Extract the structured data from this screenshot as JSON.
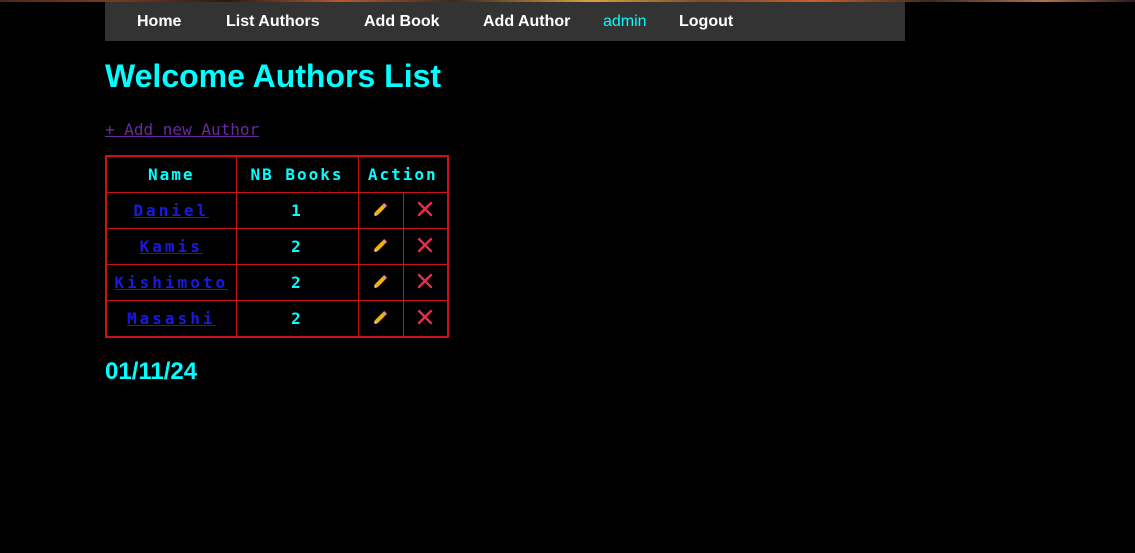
{
  "nav": {
    "home": "Home",
    "list_authors": "List Authors",
    "add_book": "Add Book",
    "add_author": "Add Author",
    "user": "admin",
    "logout": "Logout"
  },
  "page": {
    "title": "Welcome Authors List",
    "add_link": "+ Add new Author",
    "date": "01/11/24"
  },
  "table": {
    "headers": {
      "name": "Name",
      "nb_books": "NB Books",
      "action": "Action"
    },
    "rows": [
      {
        "name": "Daniel",
        "nb_books": "1"
      },
      {
        "name": "Kamis",
        "nb_books": "2"
      },
      {
        "name": "Kishimoto",
        "nb_books": "2"
      },
      {
        "name": "Masashi",
        "nb_books": "2"
      }
    ]
  },
  "icons": {
    "edit": "pencil-icon",
    "delete": "cross-icon"
  },
  "colors": {
    "accent": "#00ffff",
    "table_border": "#cc1111",
    "author_link": "#1a1adf",
    "delete": "#e0304a"
  }
}
